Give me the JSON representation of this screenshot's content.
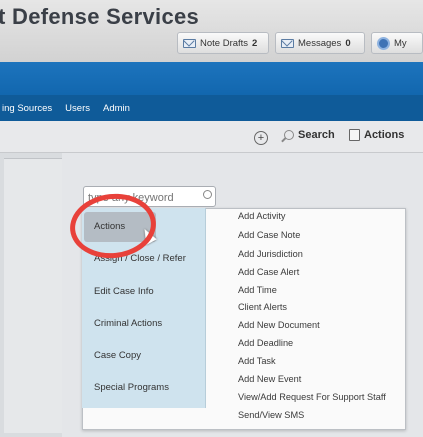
{
  "app": {
    "title": "t Defense Services"
  },
  "header_buttons": [
    {
      "label": "Note Drafts",
      "count": "2"
    },
    {
      "label": "Messages",
      "count": "0"
    },
    {
      "label": "My"
    }
  ],
  "nav": {
    "items": [
      "ing Sources",
      "Users",
      "Admin"
    ]
  },
  "toolbar": {
    "search": "Search",
    "actions": "Actions"
  },
  "keyword_search": {
    "placeholder": "type any keyword"
  },
  "actions_menu": {
    "left": [
      "Actions",
      "Assign / Close / Refer",
      "Edit Case Info",
      "Criminal Actions",
      "Case Copy",
      "Special Programs"
    ],
    "right": [
      "Add Activity",
      "Add Case Note",
      "Add Jurisdiction",
      "Add Case Alert",
      "Add Time",
      "Client Alerts",
      "Add New Document",
      "Add Deadline",
      "Add Task",
      "Add New Event",
      "View/Add Request For Support Staff",
      "Send/View SMS"
    ]
  },
  "colors": {
    "blue_band": "#1d74bd",
    "nav": "#0f5b99",
    "highlight_ring": "#e8413a",
    "menu_bg": "#cfe3ee"
  }
}
